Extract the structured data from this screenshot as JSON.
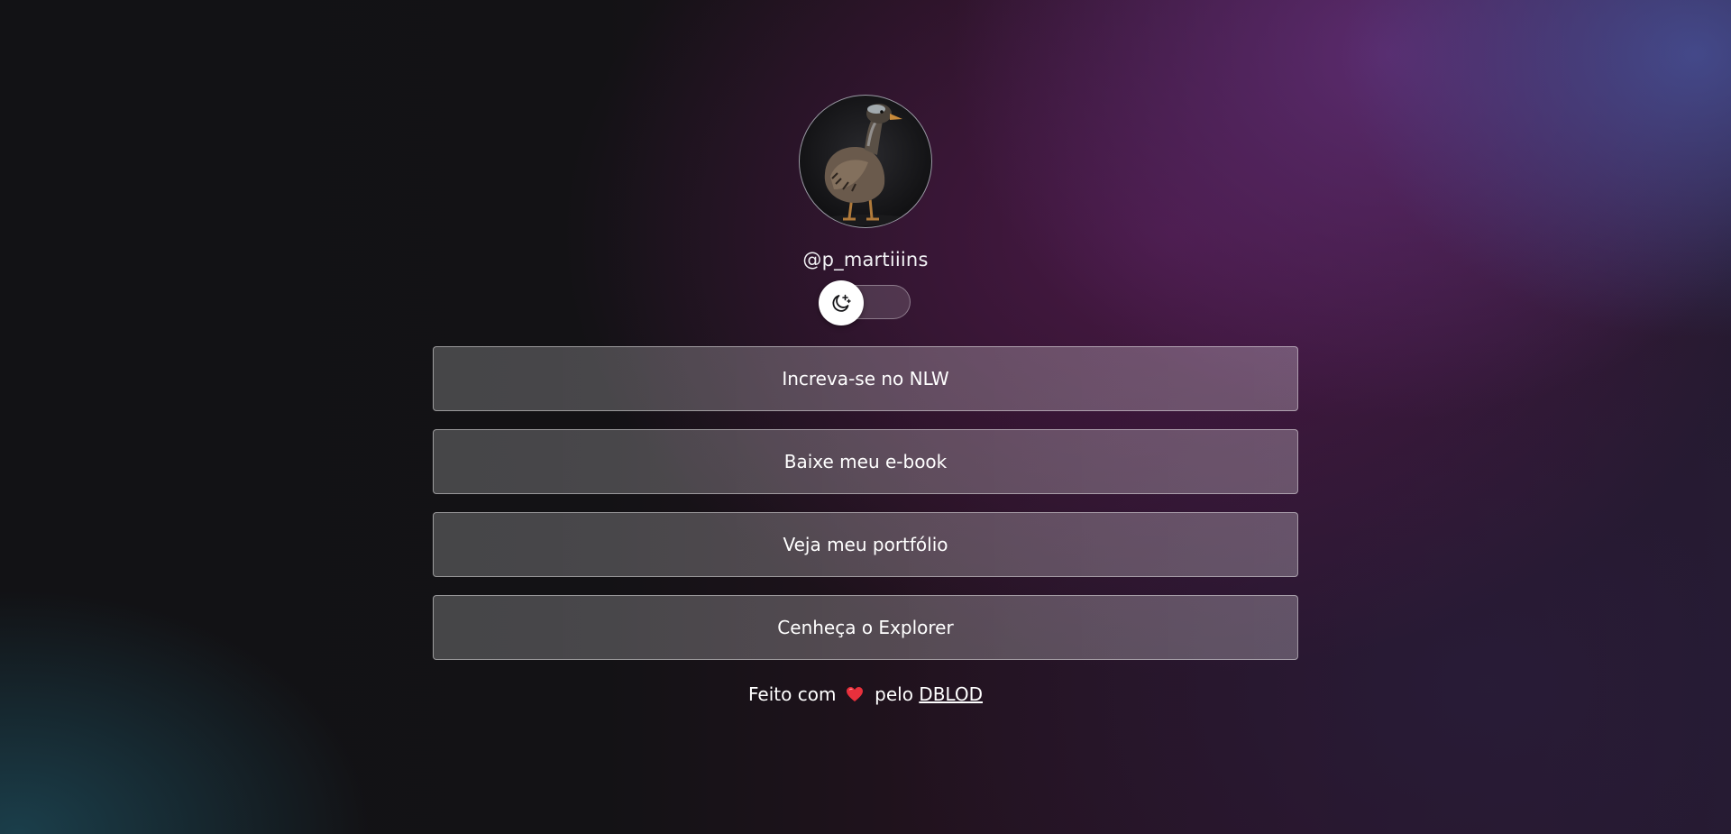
{
  "profile": {
    "avatar_alt": "duck",
    "username": "@p_martiiins"
  },
  "theme_switch": {
    "icon": "moon-stars-icon",
    "state": "dark"
  },
  "links": [
    {
      "label": "Increva-se no NLW"
    },
    {
      "label": "Baixe meu e-book"
    },
    {
      "label": "Veja meu portfólio"
    },
    {
      "label": "Cenheça o Explorer"
    }
  ],
  "footer": {
    "prefix": "Feito com",
    "heart_icon": "heart-icon",
    "middle": "pelo",
    "author_link": "DBLOD"
  },
  "colors": {
    "accent_purple": "#5a2c70",
    "heart": "#e8303c"
  }
}
